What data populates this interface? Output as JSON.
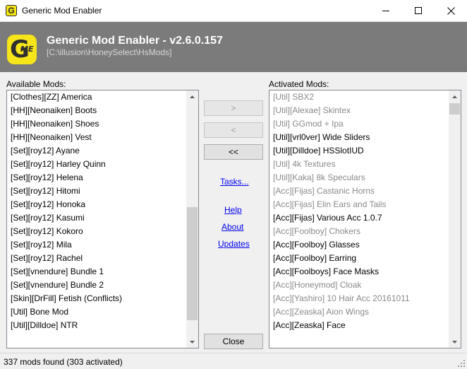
{
  "window": {
    "title": "Generic Mod Enabler",
    "icon_label": "G",
    "controls": [
      "minimize-icon",
      "maximize-icon",
      "close-icon"
    ]
  },
  "banner": {
    "logo_letter": "G",
    "logo_sub": "ME",
    "heading": "Generic Mod Enabler - v2.6.0.157",
    "path": "[C:\\illusion\\HoneySelect\\HsMods]"
  },
  "available": {
    "label": "Available Mods:",
    "items": [
      "[Clothes][ZZ] America",
      "[HH][Neonaiken] Boots",
      "[HH][Neonaiken] Shoes",
      "[HH][Neonaiken] Vest",
      "[Set][roy12] Ayane",
      "[Set][roy12] Harley Quinn",
      "[Set][roy12] Helena",
      "[Set][roy12] Hitomi",
      "[Set][roy12] Honoka",
      "[Set][roy12] Kasumi",
      "[Set][roy12] Kokoro",
      "[Set][roy12] Mila",
      "[Set][roy12] Rachel",
      "[Set][vnendure] Bundle 1",
      "[Set][vnendure] Bundle 2",
      "[Skin][DrFill] Fetish (Conflicts)",
      "[Util] Bone Mod",
      "[Util][Dilldoe] NTR"
    ],
    "scroll_position": 0.87
  },
  "activated": {
    "label": "Activated Mods:",
    "items": [
      {
        "text": "[Util] SBX2",
        "dim": true
      },
      {
        "text": "[Util][Alexae] Skintex",
        "dim": true
      },
      {
        "text": "[Util] GGmod + Ipa",
        "dim": true
      },
      {
        "text": "[Util][vrl0ver] Wide Sliders",
        "dim": false
      },
      {
        "text": "[Util][Dilldoe] HSSlotIUD",
        "dim": false
      },
      {
        "text": "[Util] 4k Textures",
        "dim": true
      },
      {
        "text": "[Util][Kaka] 8k Speculars",
        "dim": true
      },
      {
        "text": "[Acc][Fijas] Castanic Horns",
        "dim": true
      },
      {
        "text": "[Acc][Fijas] Elin Ears and Tails",
        "dim": true
      },
      {
        "text": "[Acc][Fijas] Various Acc 1.0.7",
        "dim": false
      },
      {
        "text": "[Acc][Foolboy] Chokers",
        "dim": true
      },
      {
        "text": "[Acc][Foolboy] Glasses",
        "dim": false
      },
      {
        "text": "[Acc][Foolboy] Earring",
        "dim": false
      },
      {
        "text": "[Acc][Foolboys] Face Masks",
        "dim": false
      },
      {
        "text": "[Acc][Honeymod] Cloak",
        "dim": true
      },
      {
        "text": "[Acc][Yashiro] 10 Hair Acc 20161011",
        "dim": true
      },
      {
        "text": "[Acc][Zeaska] Aion Wings",
        "dim": true
      },
      {
        "text": "[Acc][Zeaska] Face",
        "dim": false
      }
    ],
    "scroll_position": 0.0
  },
  "buttons": {
    "activate": ">",
    "deactivate": "<",
    "deactivate_all": "<<",
    "close": "Close"
  },
  "links": {
    "tasks": "Tasks...",
    "help": "Help",
    "about": "About",
    "updates": "Updates"
  },
  "status": {
    "text": "337 mods found (303 activated)"
  },
  "colors": {
    "banner": "#7b7b7b",
    "logo": "#f6e51a",
    "link": "#0000ee",
    "dim_text": "#8a8a8a"
  }
}
